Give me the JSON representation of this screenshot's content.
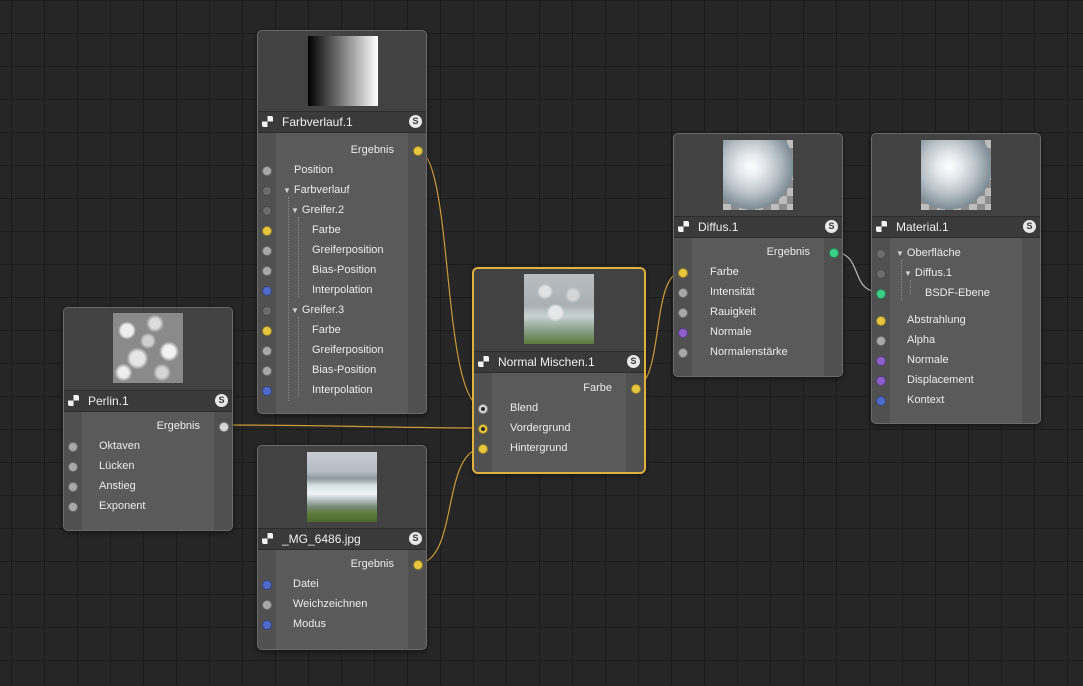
{
  "nodes": {
    "farbverlauf": {
      "title": "Farbverlauf.1",
      "output": "Ergebnis",
      "inputs": {
        "position": "Position",
        "farbverlauf": "Farbverlauf",
        "greifer2": "Greifer.2",
        "farbe1": "Farbe",
        "greiferposition1": "Greiferposition",
        "bias1": "Bias-Position",
        "interp1": "Interpolation",
        "greifer3": "Greifer.3",
        "farbe2": "Farbe",
        "greiferposition2": "Greiferposition",
        "bias2": "Bias-Position",
        "interp2": "Interpolation"
      }
    },
    "perlin": {
      "title": "Perlin.1",
      "output": "Ergebnis",
      "inputs": [
        "Oktaven",
        "Lücken",
        "Anstieg",
        "Exponent"
      ]
    },
    "image": {
      "title": "_MG_6486.jpg",
      "output": "Ergebnis",
      "inputs": [
        "Datei",
        "Weichzeichnen",
        "Modus"
      ]
    },
    "mix": {
      "title": "Normal Mischen.1",
      "output": "Farbe",
      "inputs": [
        "Blend",
        "Vordergrund",
        "Hintergrund"
      ]
    },
    "diffus": {
      "title": "Diffus.1",
      "output": "Ergebnis",
      "inputs": [
        "Farbe",
        "Intensität",
        "Rauigkeit",
        "Normale",
        "Normalenstärke"
      ]
    },
    "material": {
      "title": "Material.1",
      "tree": {
        "oberflaeche": "Oberfläche",
        "diffus": "Diffus.1",
        "bsdf": "BSDF-Ebene"
      },
      "inputs": [
        "Abstrahlung",
        "Alpha",
        "Normale",
        "Displacement",
        "Kontext"
      ]
    }
  },
  "solo_badge": "S",
  "colors": {
    "wire": "#c99a3a",
    "port_yellow": "#e6c63e",
    "port_gray": "#a8a8a8",
    "port_blue": "#4f6ac8",
    "port_purple": "#8e5fcb",
    "port_green": "#3dcf86",
    "selected_border": "#e0b23c"
  }
}
